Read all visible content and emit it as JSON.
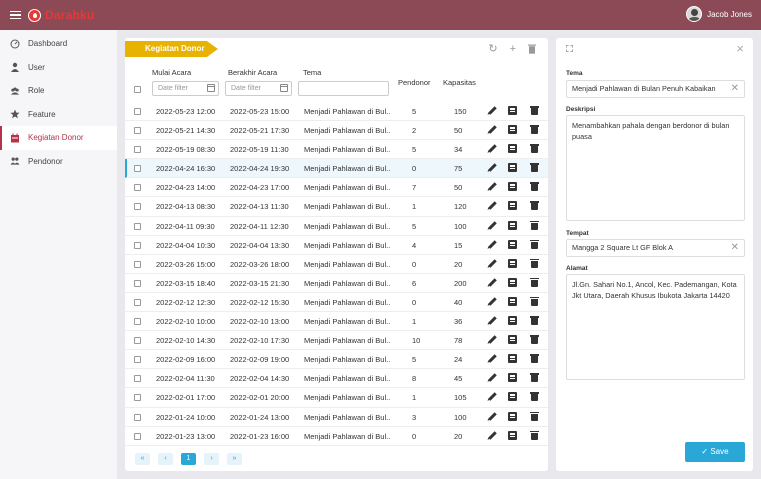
{
  "header": {
    "brand": "Darahku",
    "user_name": "Jacob Jones"
  },
  "sidebar": {
    "items": [
      {
        "label": "Dashboard",
        "icon": "dashboard-icon"
      },
      {
        "label": "User",
        "icon": "user-icon"
      },
      {
        "label": "Role",
        "icon": "role-icon"
      },
      {
        "label": "Feature",
        "icon": "star-icon"
      },
      {
        "label": "Kegiatan Donor",
        "icon": "calendar-icon",
        "active": true
      },
      {
        "label": "Pendonor",
        "icon": "people-icon"
      }
    ]
  },
  "main": {
    "title": "Kegiatan Donor",
    "toolbar": {
      "refresh": "↻",
      "add": "+",
      "delete": "🗑"
    },
    "columns": {
      "mulai": "Mulai Acara",
      "berakhir": "Berakhir Acara",
      "tema": "Tema",
      "pendonor": "Pendonor",
      "kapasitas": "Kapasitas"
    },
    "filters": {
      "mulai_placeholder": "Date filter",
      "berakhir_placeholder": "Date filter",
      "tema_placeholder": ""
    },
    "rows": [
      {
        "mulai": "2022-05-23 12:00",
        "berakhir": "2022-05-23 15:00",
        "tema": "Menjadi Pahlawan di Bul..",
        "pendonor": "5",
        "kapasitas": "150"
      },
      {
        "mulai": "2022-05-21 14:30",
        "berakhir": "2022-05-21 17:30",
        "tema": "Menjadi Pahlawan di Bul..",
        "pendonor": "2",
        "kapasitas": "50"
      },
      {
        "mulai": "2022-05-19 08:30",
        "berakhir": "2022-05-19 11:30",
        "tema": "Menjadi Pahlawan di Bul..",
        "pendonor": "5",
        "kapasitas": "34"
      },
      {
        "mulai": "2022-04-24 16:30",
        "berakhir": "2022-04-24 19:30",
        "tema": "Menjadi Pahlawan di Bul..",
        "pendonor": "0",
        "kapasitas": "75",
        "selected": true
      },
      {
        "mulai": "2022-04-23 14:00",
        "berakhir": "2022-04-23 17:00",
        "tema": "Menjadi Pahlawan di Bul..",
        "pendonor": "7",
        "kapasitas": "50"
      },
      {
        "mulai": "2022-04-13 08:30",
        "berakhir": "2022-04-13 11:30",
        "tema": "Menjadi Pahlawan di Bul..",
        "pendonor": "1",
        "kapasitas": "120"
      },
      {
        "mulai": "2022-04-11 09:30",
        "berakhir": "2022-04-11 12:30",
        "tema": "Menjadi Pahlawan di Bul..",
        "pendonor": "5",
        "kapasitas": "100"
      },
      {
        "mulai": "2022-04-04 10:30",
        "berakhir": "2022-04-04 13:30",
        "tema": "Menjadi Pahlawan di Bul..",
        "pendonor": "4",
        "kapasitas": "15"
      },
      {
        "mulai": "2022-03-26 15:00",
        "berakhir": "2022-03-26 18:00",
        "tema": "Menjadi Pahlawan di Bul..",
        "pendonor": "0",
        "kapasitas": "20"
      },
      {
        "mulai": "2022-03-15 18:40",
        "berakhir": "2022-03-15 21:30",
        "tema": "Menjadi Pahlawan di Bul..",
        "pendonor": "6",
        "kapasitas": "200"
      },
      {
        "mulai": "2022-02-12 12:30",
        "berakhir": "2022-02-12 15:30",
        "tema": "Menjadi Pahlawan di Bul..",
        "pendonor": "0",
        "kapasitas": "40"
      },
      {
        "mulai": "2022-02-10 10:00",
        "berakhir": "2022-02-10 13:00",
        "tema": "Menjadi Pahlawan di Bul..",
        "pendonor": "1",
        "kapasitas": "36"
      },
      {
        "mulai": "2022-02-10 14:30",
        "berakhir": "2022-02-10 17:30",
        "tema": "Menjadi Pahlawan di Bul..",
        "pendonor": "10",
        "kapasitas": "78"
      },
      {
        "mulai": "2022-02-09 16:00",
        "berakhir": "2022-02-09 19:00",
        "tema": "Menjadi Pahlawan di Bul..",
        "pendonor": "5",
        "kapasitas": "24"
      },
      {
        "mulai": "2022-02-04 11:30",
        "berakhir": "2022-02-04 14:30",
        "tema": "Menjadi Pahlawan di Bul..",
        "pendonor": "8",
        "kapasitas": "45"
      },
      {
        "mulai": "2022-02-01 17:00",
        "berakhir": "2022-02-01 20:00",
        "tema": "Menjadi Pahlawan di Bul..",
        "pendonor": "1",
        "kapasitas": "105"
      },
      {
        "mulai": "2022-01-24 10:00",
        "berakhir": "2022-01-24 13:00",
        "tema": "Menjadi Pahlawan di Bul..",
        "pendonor": "3",
        "kapasitas": "100"
      },
      {
        "mulai": "2022-01-23 13:00",
        "berakhir": "2022-01-23 16:00",
        "tema": "Menjadi Pahlawan di Bul..",
        "pendonor": "0",
        "kapasitas": "20"
      }
    ],
    "pager": {
      "first": "«",
      "prev": "‹",
      "current": "1",
      "next": "›",
      "last": "»"
    }
  },
  "detail": {
    "tema_label": "Tema",
    "tema_value": "Menjadi Pahlawan di Bulan Penuh Kabaikan",
    "deskripsi_label": "Deskripsi",
    "deskripsi_value": "Menambahkan pahala dengan berdonor di bulan puasa",
    "tempat_label": "Tempat",
    "tempat_value": "Mangga 2 Square Lt GF Blok A",
    "alamat_label": "Alamat",
    "alamat_value": "Jl.Gn. Sahari No.1, Ancol, Kec. Pademangan, Kota Jkt Utara, Daerah Khusus Ibukota Jakarta 14420",
    "save_label": "Save"
  },
  "colors": {
    "topbar": "#8c4a57",
    "accent": "#b5334a",
    "brand": "#e53935",
    "ribbon": "#e8b300",
    "primary": "#29a8d8"
  }
}
